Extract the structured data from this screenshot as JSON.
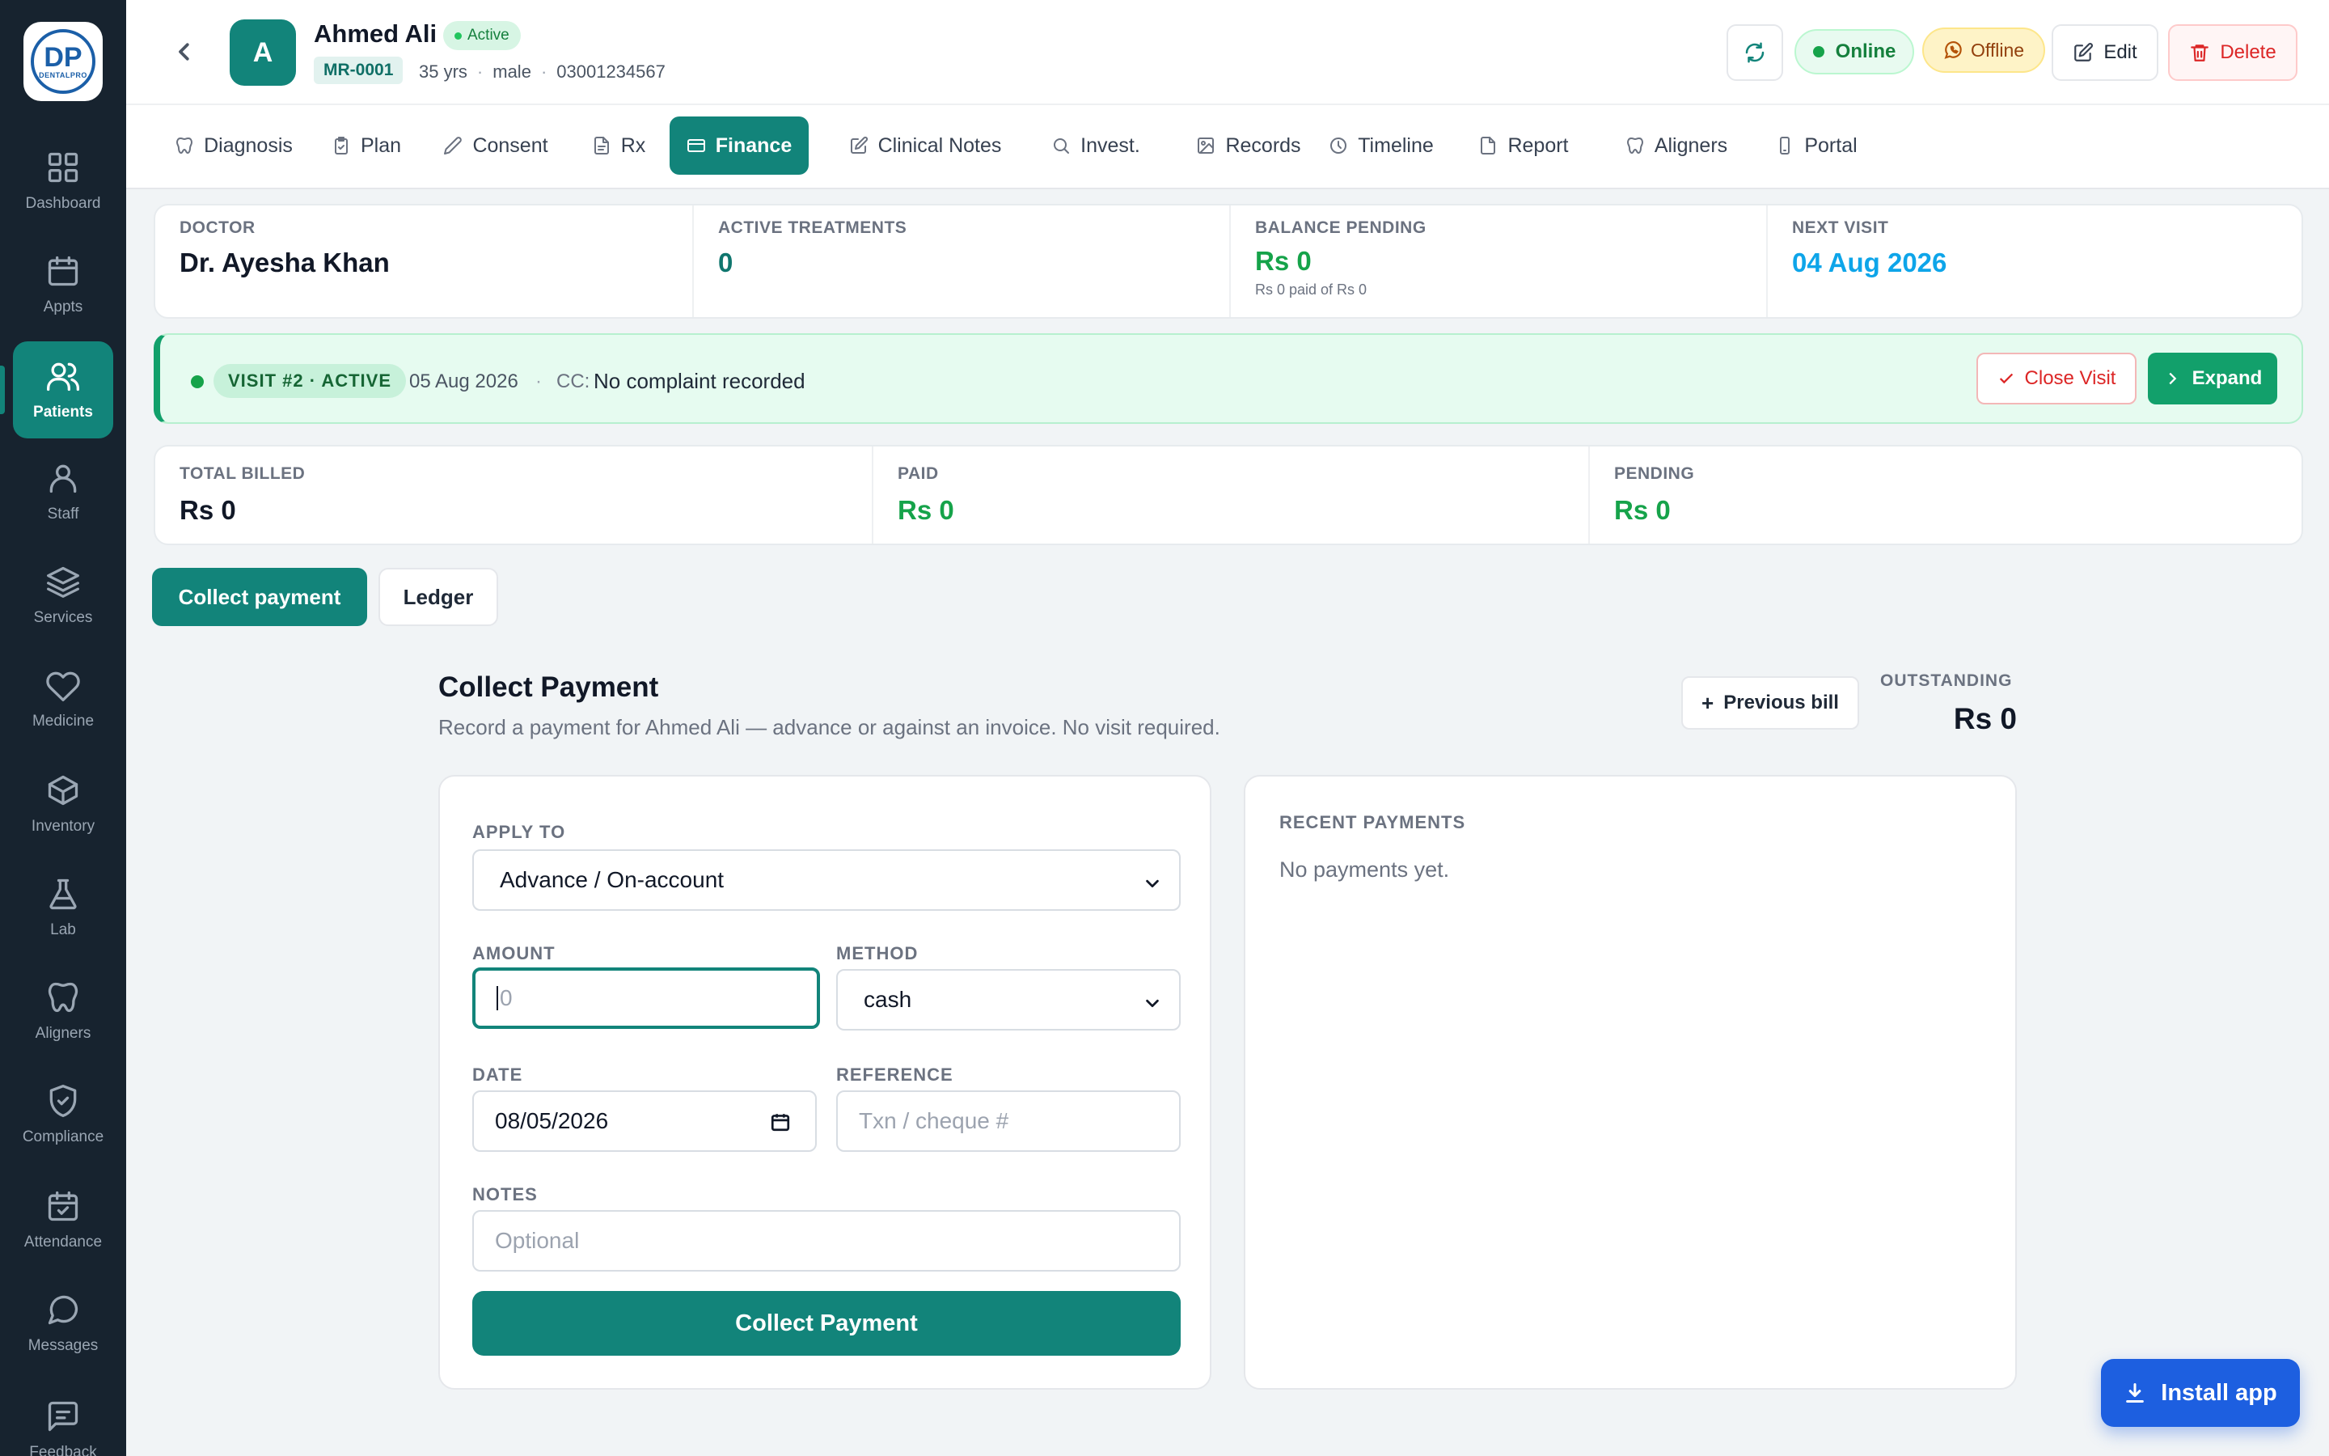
{
  "brand": {
    "logo_mark": "DP",
    "logo_text": "DENTALPRO"
  },
  "sidebar": {
    "items": [
      {
        "label": "Dashboard",
        "icon": "grid-icon"
      },
      {
        "label": "Appts",
        "icon": "calendar-icon"
      },
      {
        "label": "Patients",
        "icon": "users-icon",
        "active": true
      },
      {
        "label": "Staff",
        "icon": "user-icon"
      },
      {
        "label": "Services",
        "icon": "layers-icon"
      },
      {
        "label": "Medicine",
        "icon": "heart-icon"
      },
      {
        "label": "Inventory",
        "icon": "box-icon"
      },
      {
        "label": "Lab",
        "icon": "flask-icon"
      },
      {
        "label": "Aligners",
        "icon": "tooth-icon"
      },
      {
        "label": "Compliance",
        "icon": "shield-check-icon"
      },
      {
        "label": "Attendance",
        "icon": "calendar-check-icon"
      },
      {
        "label": "Messages",
        "icon": "message-circle-icon"
      },
      {
        "label": "Feedback",
        "icon": "message-square-icon"
      }
    ]
  },
  "patient": {
    "initial": "A",
    "name": "Ahmed Ali",
    "status": "Active",
    "mr": "MR-0001",
    "age": "35 yrs",
    "gender": "male",
    "phone": "03001234567"
  },
  "header_actions": {
    "online": "Online",
    "offline": "Offline",
    "edit": "Edit",
    "delete": "Delete"
  },
  "tabs": [
    {
      "label": "Diagnosis",
      "icon": "tooth-icon"
    },
    {
      "label": "Plan",
      "icon": "clipboard-icon"
    },
    {
      "label": "Consent",
      "icon": "pen-icon"
    },
    {
      "label": "Rx",
      "icon": "file-icon"
    },
    {
      "label": "Finance",
      "icon": "credit-card-icon",
      "active": true
    },
    {
      "label": "Clinical Notes",
      "icon": "edit-icon"
    },
    {
      "label": "Invest.",
      "icon": "search-icon"
    },
    {
      "label": "Records",
      "icon": "image-icon"
    },
    {
      "label": "Timeline",
      "icon": "clock-icon"
    },
    {
      "label": "Report",
      "icon": "document-icon"
    },
    {
      "label": "Aligners",
      "icon": "tooth-icon"
    },
    {
      "label": "Portal",
      "icon": "smartphone-icon"
    }
  ],
  "summary": {
    "doctor_label": "DOCTOR",
    "doctor_value": "Dr. Ayesha Khan",
    "treatments_label": "ACTIVE TREATMENTS",
    "treatments_value": "0",
    "balance_label": "BALANCE PENDING",
    "balance_value": "Rs 0",
    "balance_sub": "Rs 0 paid of Rs 0",
    "next_label": "NEXT VISIT",
    "next_value": "04 Aug 2026"
  },
  "visit": {
    "tag": "VISIT #2 · ACTIVE",
    "date": "05 Aug 2026",
    "separator": "·",
    "cc_label": "CC:",
    "cc_text": "No complaint recorded",
    "close_label": "Close Visit",
    "expand_label": "Expand"
  },
  "totals": {
    "billed_label": "TOTAL BILLED",
    "billed_value": "Rs 0",
    "paid_label": "PAID",
    "paid_value": "Rs 0",
    "pending_label": "PENDING",
    "pending_value": "Rs 0"
  },
  "subtabs": {
    "collect": "Collect payment",
    "ledger": "Ledger"
  },
  "collect": {
    "title": "Collect Payment",
    "subtitle": "Record a payment for Ahmed Ali — advance or against an invoice. No visit required.",
    "prev_bill": "Previous bill",
    "outstanding_label": "OUTSTANDING",
    "outstanding_value": "Rs 0",
    "apply_label": "APPLY TO",
    "apply_value": "Advance / On-account",
    "amount_label": "AMOUNT",
    "amount_placeholder": "0",
    "method_label": "METHOD",
    "method_value": "cash",
    "date_label": "DATE",
    "date_value": "08/05/2026",
    "reference_label": "REFERENCE",
    "reference_placeholder": "Txn / cheque #",
    "notes_label": "NOTES",
    "notes_placeholder": "Optional",
    "submit": "Collect Payment"
  },
  "recent": {
    "label": "RECENT PAYMENTS",
    "empty": "No payments yet."
  },
  "install": {
    "label": "Install app"
  },
  "colors": {
    "accent": "#12847a",
    "sidebar": "#17232f",
    "install": "#1d5fe0",
    "danger": "#dc2626"
  }
}
